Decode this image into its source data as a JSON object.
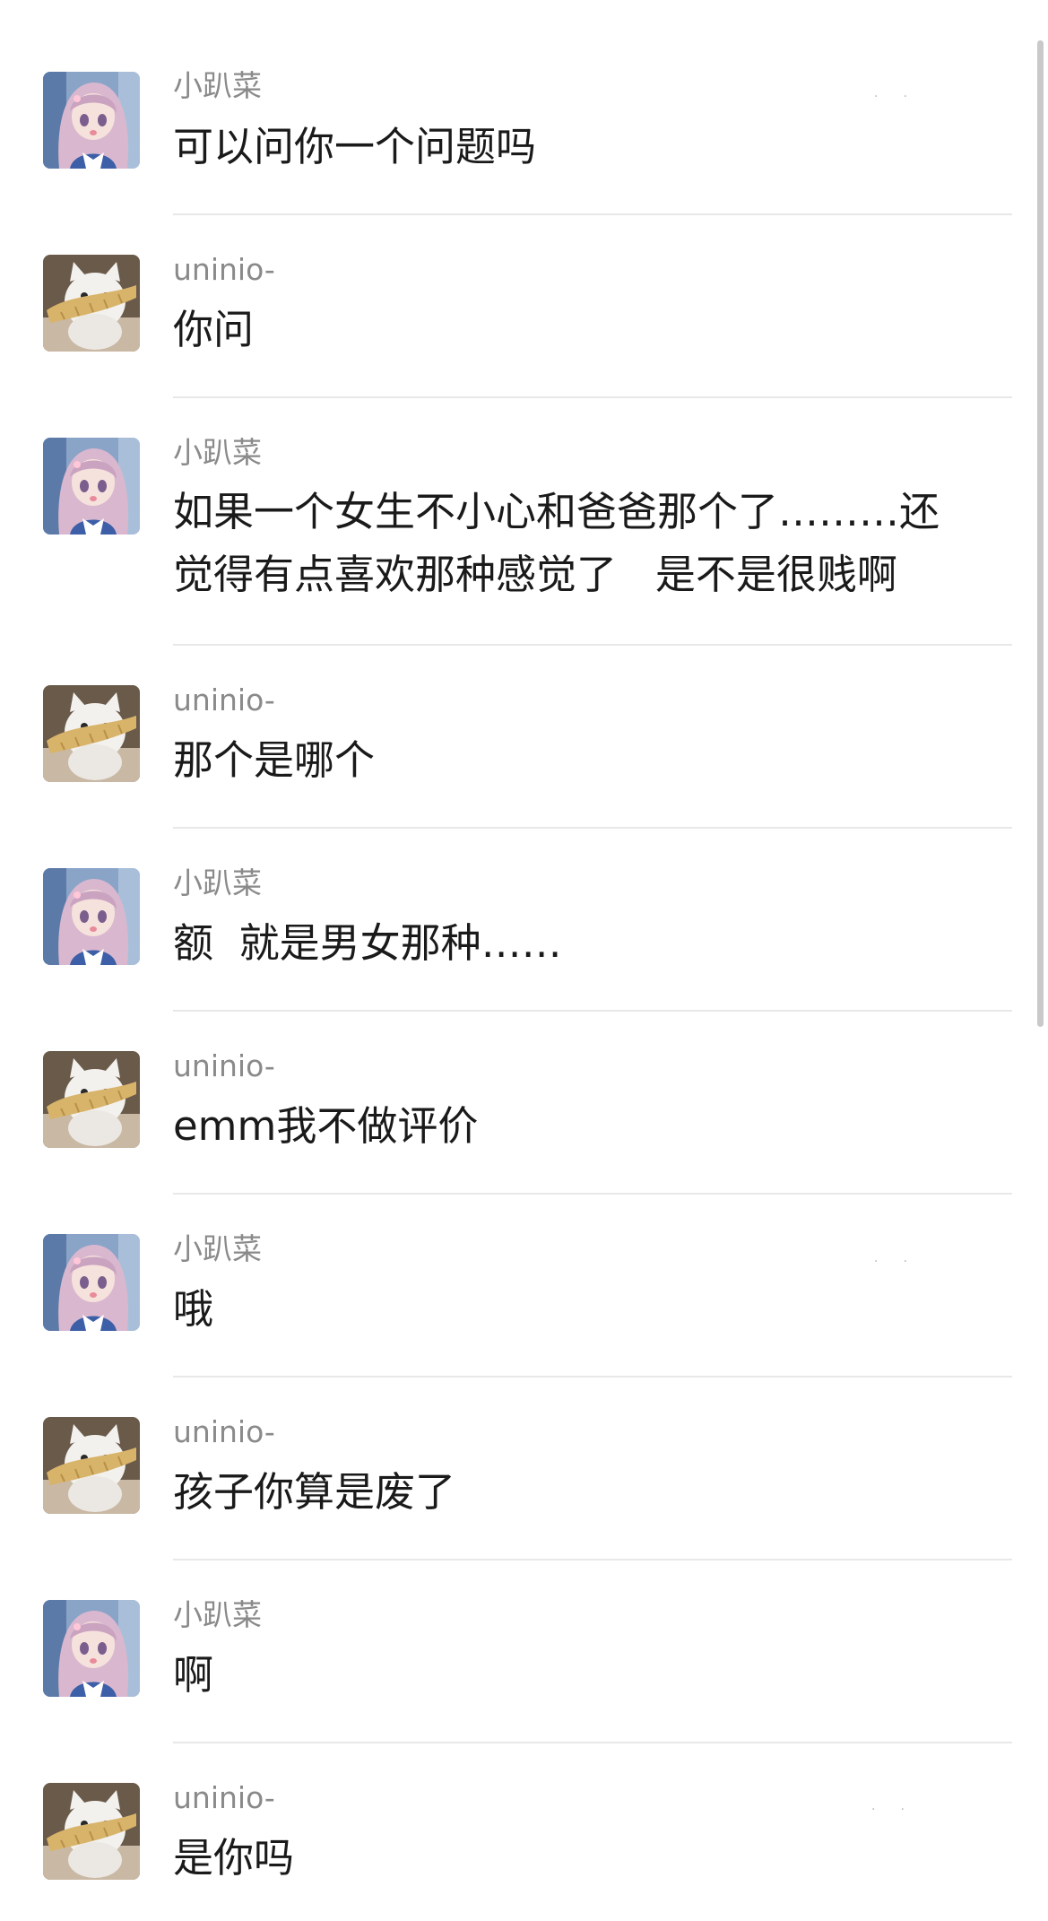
{
  "users": {
    "a": "小趴菜",
    "b": "uninio-"
  },
  "messages": [
    {
      "sender": "小趴菜",
      "text": "可以问你一个问题吗"
    },
    {
      "sender": "uninio-",
      "text": "你问"
    },
    {
      "sender": "小趴菜",
      "text": "如果一个女生不小心和爸爸那个了………还\n觉得有点喜欢那种感觉了   是不是很贱啊"
    },
    {
      "sender": "uninio-",
      "text": "那个是哪个"
    },
    {
      "sender": "小趴菜",
      "text": "额  就是男女那种……"
    },
    {
      "sender": "uninio-",
      "text": "emm我不做评价"
    },
    {
      "sender": "小趴菜",
      "text": "哦"
    },
    {
      "sender": "uninio-",
      "text": "孩子你算是废了"
    },
    {
      "sender": "小趴菜",
      "text": "啊"
    },
    {
      "sender": "uninio-",
      "text": "是你吗"
    }
  ],
  "icons": {
    "avatar_a": "anime-girl-avatar",
    "avatar_b": "cat-with-fish-avatar"
  },
  "colors": {
    "name": "#8a8a8a",
    "text": "#1a1a1a",
    "divider": "#e8e8e8"
  }
}
